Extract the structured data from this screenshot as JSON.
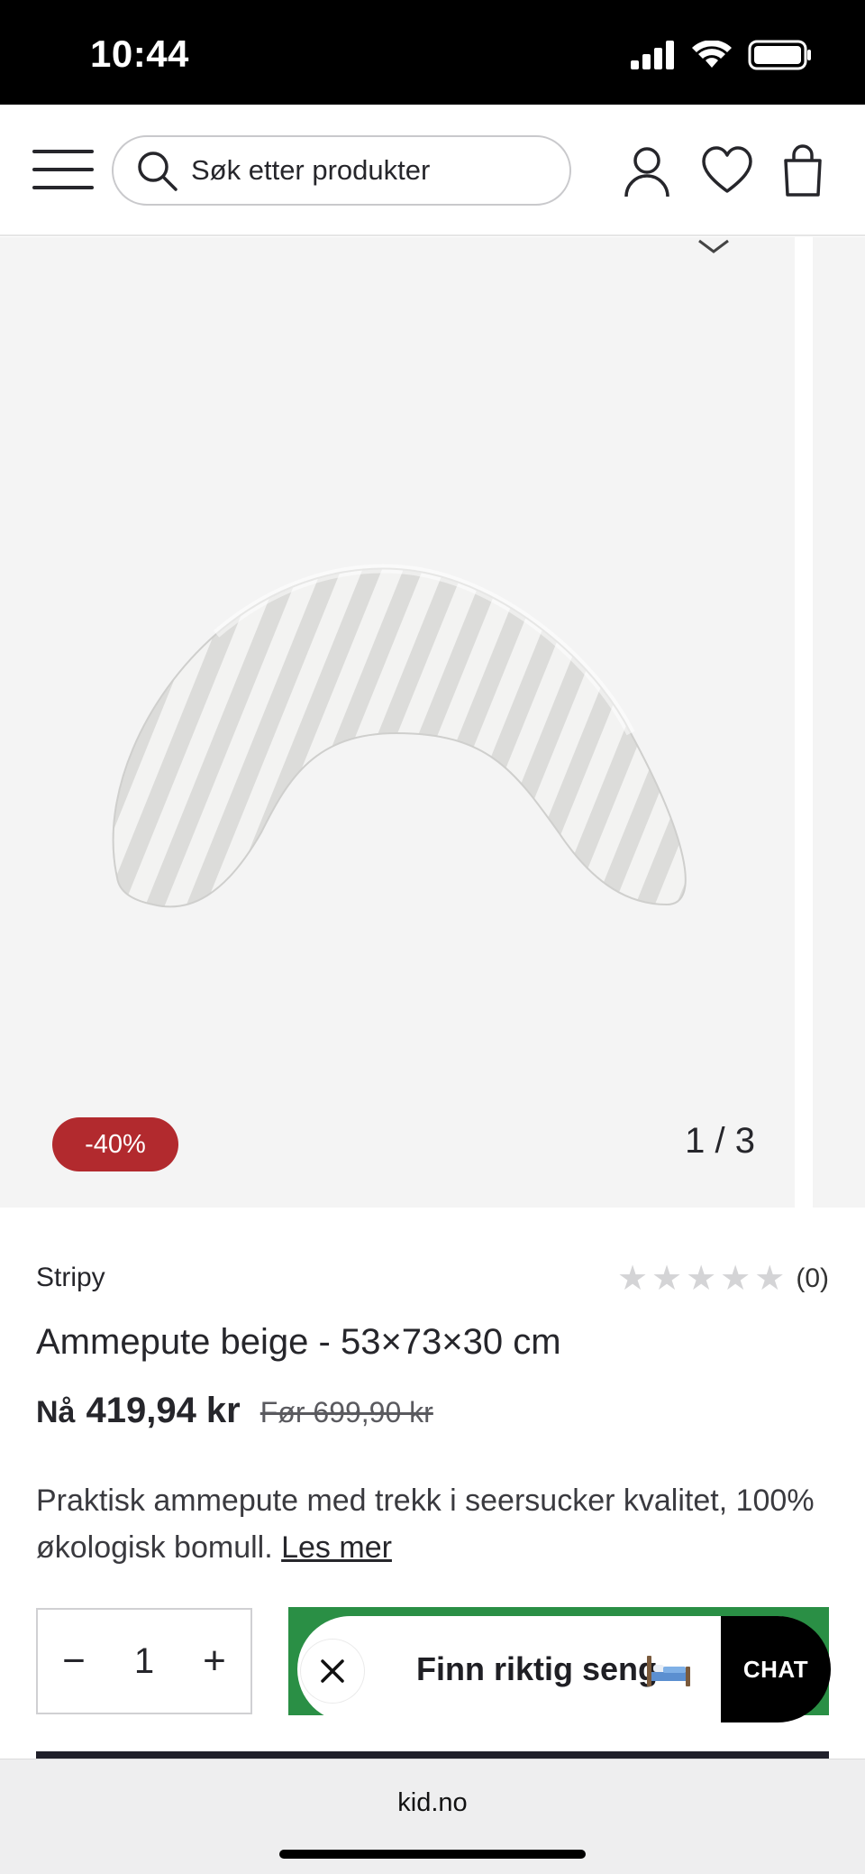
{
  "status_bar": {
    "time": "10:44"
  },
  "header": {
    "search_placeholder": "Søk etter produkter"
  },
  "gallery": {
    "discount_badge": "-40%",
    "counter": "1 / 3"
  },
  "product": {
    "brand": "Stripy",
    "rating_stars": 5,
    "rating_count": "(0)",
    "title": "Ammepute beige - 53×73×30 cm",
    "price_now_label": "Nå",
    "price_now": "419,94 kr",
    "price_before": "Før 699,90 kr",
    "description": "Praktisk ammepute med trekk i seersucker kvalitet, 100% økologisk bomull.",
    "read_more": "Les mer"
  },
  "purchase": {
    "quantity": "1",
    "minus_label": "−",
    "plus_label": "+"
  },
  "chat_widget": {
    "promo_text": "Finn riktig seng",
    "chat_label": "CHAT"
  },
  "browser": {
    "url": "kid.no"
  },
  "colors": {
    "discount": "#b22a2e",
    "cart_green": "#2a8f45",
    "chat_black": "#000000"
  }
}
